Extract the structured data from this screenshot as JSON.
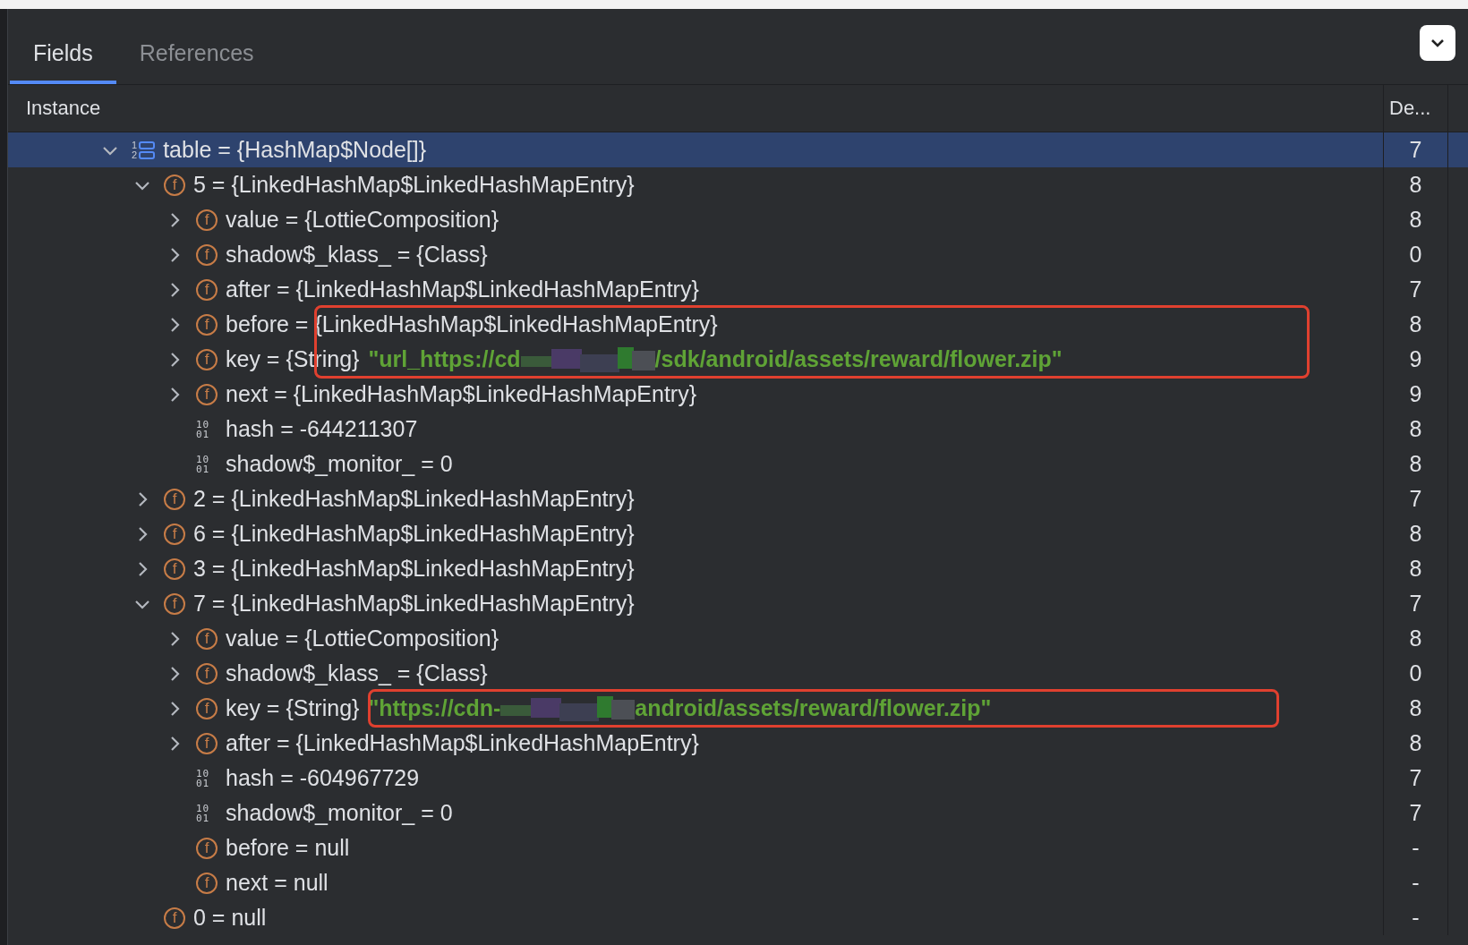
{
  "tabs": [
    {
      "label": "Fields",
      "selected": true
    },
    {
      "label": "References",
      "selected": false
    }
  ],
  "columns": {
    "instance": "Instance",
    "column_2": "De..."
  },
  "tree": [
    {
      "kind": "array",
      "badge": [
        "1",
        "2"
      ],
      "label": "table = {HashMap$Node[]}",
      "depth_value": "7",
      "expanded": true,
      "selected": true,
      "children": [
        {
          "kind": "field",
          "badge": [
            "f"
          ],
          "label": "5 = {LinkedHashMap$LinkedHashMapEntry}",
          "depth_value": "8",
          "expanded": true,
          "selected": false,
          "children": [
            {
              "kind": "field",
              "badge": [
                "f"
              ],
              "label": "value = {LottieComposition}",
              "depth_value": "8",
              "expanded": false,
              "selected": false
            },
            {
              "kind": "field",
              "badge": [
                "f"
              ],
              "label": "shadow$_klass_ = {Class}",
              "depth_value": "0",
              "expanded": false,
              "selected": false
            },
            {
              "kind": "field",
              "badge": [
                "f"
              ],
              "label": "after = {LinkedHashMap$LinkedHashMapEntry}",
              "depth_value": "7",
              "expanded": false,
              "selected": false
            },
            {
              "kind": "field",
              "badge": [
                "f"
              ],
              "label": "before = {LinkedHashMap$LinkedHashMapEntry}",
              "depth_value": "8",
              "expanded": false,
              "selected": false,
              "annotated": true
            },
            {
              "kind": "field",
              "badge": [
                "f"
              ],
              "label": "key = {String}",
              "string_start": "\"url_https://cd",
              "string_end": "/sdk/android/assets/reward/flower.zip\"",
              "depth_value": "9",
              "expanded": false,
              "selected": false,
              "annotated": true
            },
            {
              "kind": "field",
              "badge": [
                "f"
              ],
              "label": "next = {LinkedHashMap$LinkedHashMapEntry}",
              "depth_value": "9",
              "expanded": false,
              "selected": false
            },
            {
              "kind": "primitive",
              "badge": [
                "10",
                "01"
              ],
              "label": "hash = -644211307",
              "depth_value": "8",
              "selected": false
            },
            {
              "kind": "primitive",
              "badge": [
                "10",
                "01"
              ],
              "label": "shadow$_monitor_ = 0",
              "depth_value": "8",
              "selected": false
            }
          ]
        },
        {
          "kind": "field",
          "badge": [
            "f"
          ],
          "label": "2 = {LinkedHashMap$LinkedHashMapEntry}",
          "depth_value": "7",
          "expanded": false,
          "selected": false
        },
        {
          "kind": "field",
          "badge": [
            "f"
          ],
          "label": "6 = {LinkedHashMap$LinkedHashMapEntry}",
          "depth_value": "8",
          "expanded": false,
          "selected": false
        },
        {
          "kind": "field",
          "badge": [
            "f"
          ],
          "label": "3 = {LinkedHashMap$LinkedHashMapEntry}",
          "depth_value": "8",
          "expanded": false,
          "selected": false
        },
        {
          "kind": "field",
          "badge": [
            "f"
          ],
          "label": "7 = {LinkedHashMap$LinkedHashMapEntry}",
          "depth_value": "7",
          "expanded": true,
          "selected": false,
          "children": [
            {
              "kind": "field",
              "badge": [
                "f"
              ],
              "label": "value = {LottieComposition}",
              "depth_value": "8",
              "expanded": false,
              "selected": false
            },
            {
              "kind": "field",
              "badge": [
                "f"
              ],
              "label": "shadow$_klass_ = {Class}",
              "depth_value": "0",
              "expanded": false,
              "selected": false
            },
            {
              "kind": "field",
              "badge": [
                "f"
              ],
              "label": "key = {String}",
              "string_start": "\"https://cdn-",
              "string_end": "android/assets/reward/flower.zip\"",
              "depth_value": "8",
              "expanded": false,
              "selected": false,
              "annotated": true
            },
            {
              "kind": "field",
              "badge": [
                "f"
              ],
              "label": "after = {LinkedHashMap$LinkedHashMapEntry}",
              "depth_value": "8",
              "expanded": false,
              "selected": false
            },
            {
              "kind": "primitive",
              "badge": [
                "10",
                "01"
              ],
              "label": "hash = -604967729",
              "depth_value": "7",
              "selected": false
            },
            {
              "kind": "primitive",
              "badge": [
                "10",
                "01"
              ],
              "label": "shadow$_monitor_ = 0",
              "depth_value": "7",
              "selected": false
            },
            {
              "kind": "field",
              "badge": [
                "f"
              ],
              "label": "before = null",
              "depth_value": "-",
              "selected": false
            },
            {
              "kind": "field",
              "badge": [
                "f"
              ],
              "label": "next = null",
              "depth_value": "-",
              "selected": false
            }
          ]
        },
        {
          "kind": "field",
          "badge": [
            "f"
          ],
          "label": "0 = null",
          "depth_value": "-",
          "selected": false
        }
      ]
    }
  ]
}
